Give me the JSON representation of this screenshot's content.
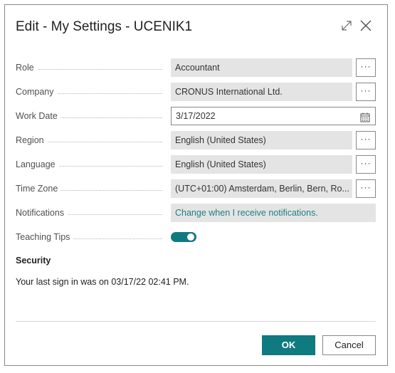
{
  "dialog": {
    "title": "Edit - My Settings - UCENIK1",
    "expand_icon": "expand-icon",
    "close_icon": "close-icon"
  },
  "fields": {
    "role": {
      "label": "Role",
      "value": "Accountant"
    },
    "company": {
      "label": "Company",
      "value": "CRONUS International Ltd."
    },
    "work_date": {
      "label": "Work Date",
      "value": "3/17/2022"
    },
    "region": {
      "label": "Region",
      "value": "English (United States)"
    },
    "language": {
      "label": "Language",
      "value": "English (United States)"
    },
    "time_zone": {
      "label": "Time Zone",
      "value": "(UTC+01:00) Amsterdam, Berlin, Bern, Ro..."
    },
    "notifications": {
      "label": "Notifications",
      "value": "Change when I receive notifications."
    },
    "teaching_tips": {
      "label": "Teaching Tips",
      "enabled": true
    }
  },
  "ellipsis": "···",
  "security": {
    "heading": "Security",
    "last_sign_in": "Your last sign in was on 03/17/22 02:41 PM."
  },
  "buttons": {
    "ok": "OK",
    "cancel": "Cancel"
  },
  "colors": {
    "accent": "#0f7a80",
    "link": "#1f7f83",
    "field_bg": "#e4e4e4"
  }
}
